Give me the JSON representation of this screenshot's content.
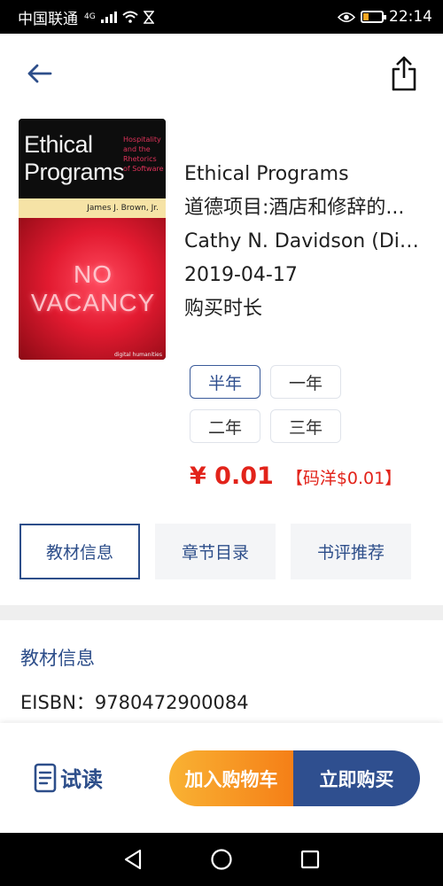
{
  "status_bar": {
    "carrier": "中国联通",
    "network": "4G",
    "time": "22:14",
    "battery_level": 0.3,
    "battery_color": "#f5a623"
  },
  "header": {
    "back_icon": "back-arrow-icon",
    "share_icon": "share-icon"
  },
  "book": {
    "cover": {
      "title_line1": "Ethical",
      "title_line2": "Programs",
      "subtitle": "Hospitality and the Rhetorics of Software",
      "author": "James J. Brown, Jr.",
      "sign_line1": "NO",
      "sign_line2": "VACANCY",
      "footer": "digital humanities"
    },
    "title": "Ethical Programs",
    "subtitle_cn": "道德项目:酒店和修辞的...",
    "author": "Cathy N. Davidson (Disti...",
    "date": "2019-04-17",
    "duration_label": "购买时长"
  },
  "durations": {
    "options": [
      "半年",
      "一年",
      "二年",
      "三年"
    ],
    "selected": "半年"
  },
  "price": {
    "main": "¥ 0.01",
    "original": "【码洋$0.01】"
  },
  "tabs": {
    "items": [
      "教材信息",
      "章节目录",
      "书评推荐"
    ],
    "active": "教材信息"
  },
  "details": {
    "section_title": "教材信息",
    "isbn_line": "EISBN：9780472900084"
  },
  "actions": {
    "trial_label": "试读",
    "cart_label": "加入购物车",
    "buy_label": "立即购买"
  },
  "colors": {
    "accent": "#2d4e8a",
    "price": "#e2231a",
    "cart_start": "#f9b233",
    "cart_end": "#f57f17",
    "buy": "#2f4f8f"
  }
}
